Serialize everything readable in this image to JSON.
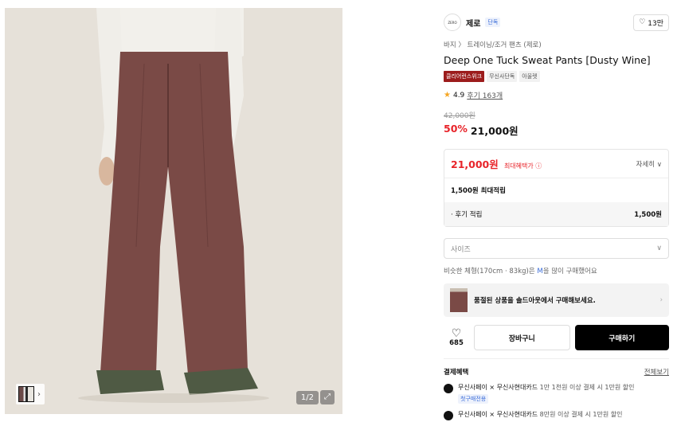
{
  "image": {
    "counter": "1/2",
    "expand_icon": "expand-icon",
    "thumb_arrow": "›"
  },
  "brand": {
    "logo_text": "ZERO",
    "name": "제로",
    "tag": "단독",
    "like_count": "13만"
  },
  "breadcrumb": "바지 〉 트레이닝/조거 팬츠 (제로)",
  "product": {
    "title": "Deep One Tuck Sweat Pants [Dusty Wine]",
    "badges": [
      "클리어런스위크",
      "무신사단독",
      "아울렛"
    ],
    "rating": "4.9",
    "reviews": "후기 163개",
    "original_price": "42,000원",
    "discount": "50%",
    "sale_price": "21,000원"
  },
  "benefit": {
    "max_price": "21,000원",
    "max_label": "최대혜택가 ⓘ",
    "more": "자세히 ∨",
    "points": "1,500원 최대적립",
    "review_points_label": "· 후기 적립",
    "review_points_value": "1,500원"
  },
  "size": {
    "placeholder": "사이즈"
  },
  "fit_note": {
    "prefix": "비슷한 체형(170cm · 83kg)은 ",
    "size": "M",
    "suffix": "을 많이 구매했어요"
  },
  "soldout_banner": "품절된 상품을 솔드아웃에서 구매해보세요.",
  "actions": {
    "heart_count": "685",
    "cart": "장바구니",
    "buy": "구매하기"
  },
  "payment": {
    "title": "결제혜택",
    "view_all": "전체보기",
    "items": [
      {
        "brand": "무신사페이 × 무신사현대카드",
        "text": " 1만 1천원 이상 결제 시 1만원 할인",
        "sub": "첫구매전용"
      },
      {
        "brand": "무신사페이 × 무신사현대카드",
        "text": " 8만원 이상 결제 시 1만원 할인",
        "sub": ""
      }
    ]
  },
  "colors": {
    "accent_red": "#e8242a",
    "pants": "#7a4a46",
    "background": "#e8e3dc"
  }
}
